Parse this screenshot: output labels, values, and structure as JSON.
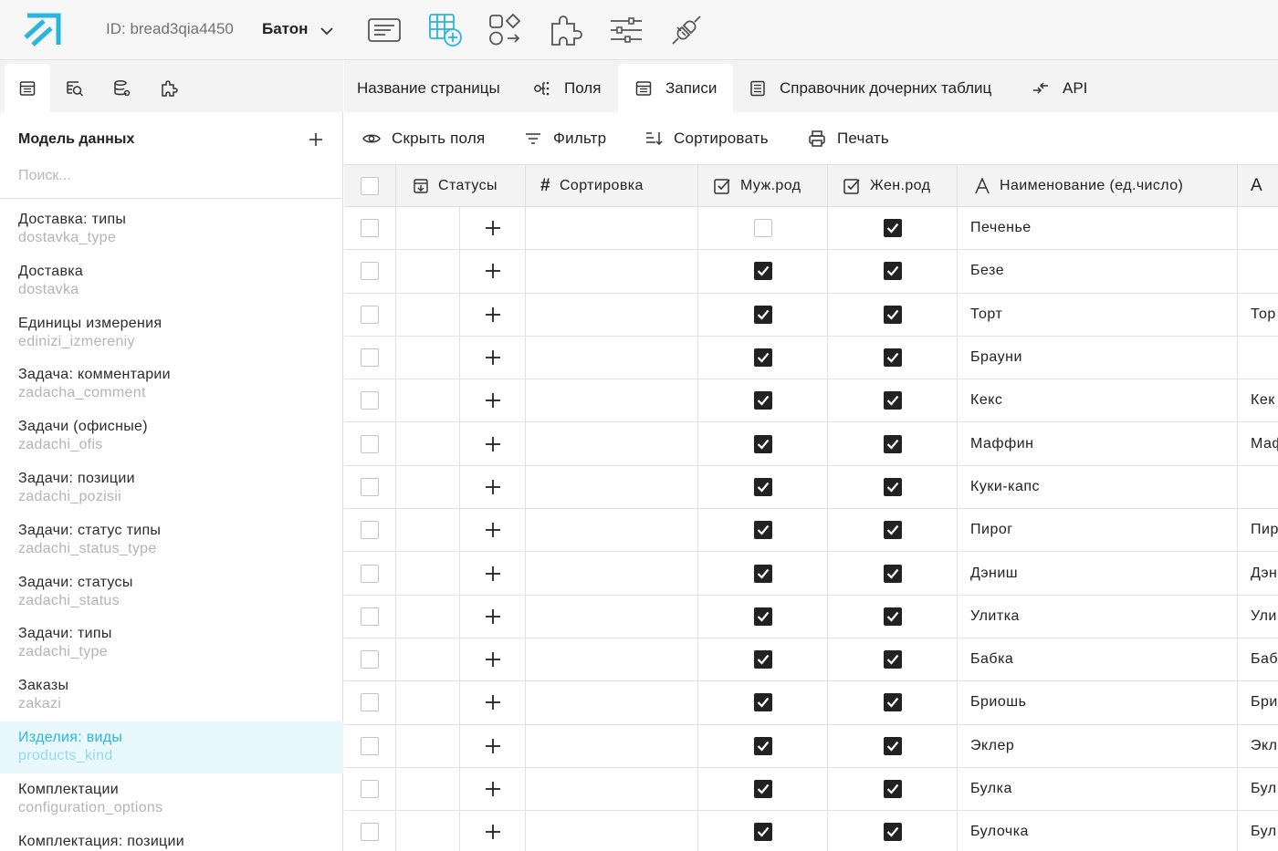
{
  "header": {
    "project_id": "ID: bread3qia4450",
    "project_name": "Батон",
    "icons": [
      "pages-icon",
      "table-add-icon",
      "components-icon",
      "plugins-icon",
      "settings-sliders-icon",
      "integrations-plug-icon"
    ]
  },
  "sidebar": {
    "tabs": [
      "tables-icon",
      "table-search-icon",
      "database-settings-icon",
      "plugins-icon"
    ],
    "title": "Модель данных",
    "search_placeholder": "Поиск...",
    "items": [
      {
        "name": "Доставка: типы",
        "key": "dostavka_type"
      },
      {
        "name": "Доставка",
        "key": "dostavka"
      },
      {
        "name": "Единицы измерения",
        "key": "edinizi_izmereniy"
      },
      {
        "name": "Задача: комментарии",
        "key": "zadacha_comment"
      },
      {
        "name": "Задачи (офисные)",
        "key": "zadachi_ofis"
      },
      {
        "name": "Задачи: позиции",
        "key": "zadachi_pozisii"
      },
      {
        "name": "Задачи: статус типы",
        "key": "zadachi_status_type"
      },
      {
        "name": "Задачи: статусы",
        "key": "zadachi_status"
      },
      {
        "name": "Задачи: типы",
        "key": "zadachi_type"
      },
      {
        "name": "Заказы",
        "key": "zakazi"
      },
      {
        "name": "Изделия: виды",
        "key": "products_kind"
      },
      {
        "name": "Комплектации",
        "key": "configuration_options"
      },
      {
        "name": "Комплектация: позиции",
        "key": ""
      }
    ],
    "active_index": 10
  },
  "page_tabs": {
    "page_name": "Название страницы",
    "fields": "Поля",
    "records": "Записи",
    "child_tables": "Справочник дочерних таблиц",
    "api": "API"
  },
  "toolbar": {
    "hide_fields": "Скрыть поля",
    "filter": "Фильтр",
    "sort": "Сортировать",
    "print": "Печать"
  },
  "table": {
    "columns": {
      "statuses": "Статусы",
      "sorting": "Сортировка",
      "masculine": "Муж.род",
      "feminine": "Жен.род",
      "name_singular": "Наименование (ед.число)",
      "next": "А"
    },
    "rows": [
      {
        "masc": false,
        "fem": true,
        "name": "Печенье",
        "extra": ""
      },
      {
        "masc": true,
        "fem": true,
        "name": "Безе",
        "extra": ""
      },
      {
        "masc": true,
        "fem": true,
        "name": "Торт",
        "extra": "Тор"
      },
      {
        "masc": true,
        "fem": true,
        "name": "Брауни",
        "extra": ""
      },
      {
        "masc": true,
        "fem": true,
        "name": "Кекс",
        "extra": "Кек"
      },
      {
        "masc": true,
        "fem": true,
        "name": "Маффин",
        "extra": "Маф"
      },
      {
        "masc": true,
        "fem": true,
        "name": "Куки-капс",
        "extra": ""
      },
      {
        "masc": true,
        "fem": true,
        "name": "Пирог",
        "extra": "Пир"
      },
      {
        "masc": true,
        "fem": true,
        "name": "Дэниш",
        "extra": "Дэн"
      },
      {
        "masc": true,
        "fem": true,
        "name": "Улитка",
        "extra": "Ули"
      },
      {
        "masc": true,
        "fem": true,
        "name": "Бабка",
        "extra": "Баб"
      },
      {
        "masc": true,
        "fem": true,
        "name": "Бриошь",
        "extra": "Бри"
      },
      {
        "masc": true,
        "fem": true,
        "name": "Эклер",
        "extra": "Экл"
      },
      {
        "masc": true,
        "fem": true,
        "name": "Булка",
        "extra": "Бул"
      },
      {
        "masc": true,
        "fem": true,
        "name": "Булочка",
        "extra": "Бул"
      }
    ]
  },
  "colors": {
    "accent": "#2ab8dd",
    "active_bg": "#e9f8fc",
    "muted_text": "#b4b4b4"
  }
}
